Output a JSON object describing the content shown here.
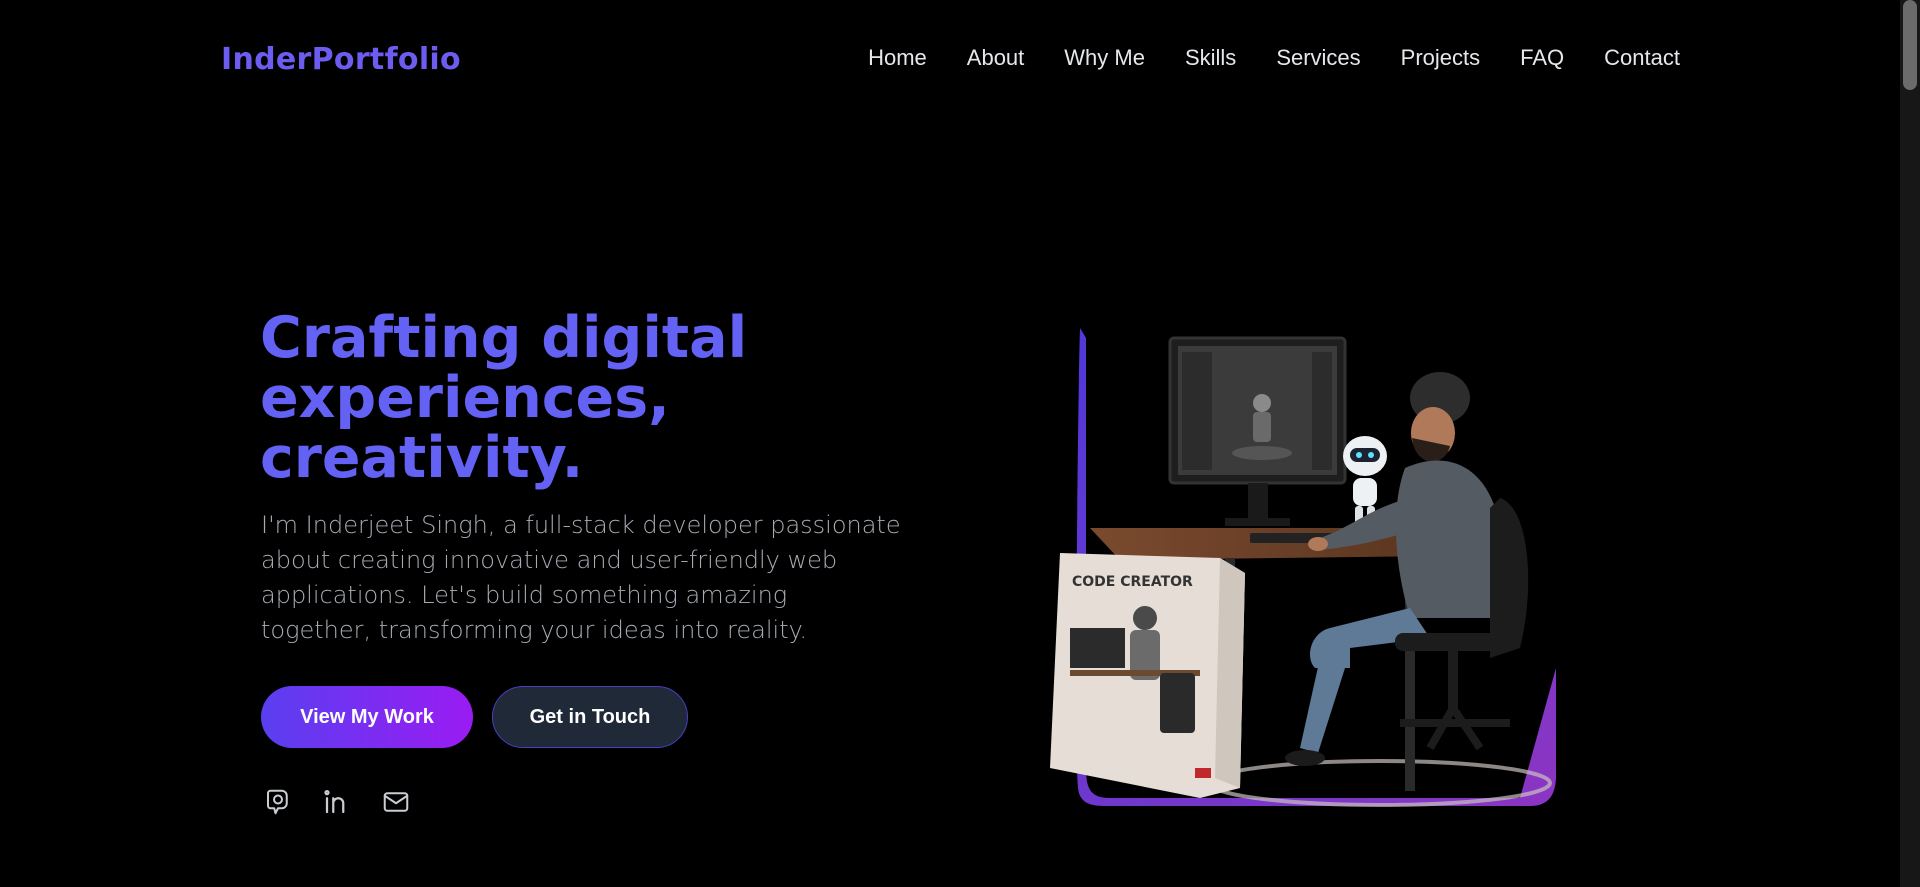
{
  "nav": {
    "logo": "InderPortfolio",
    "links": [
      "Home",
      "About",
      "Why Me",
      "Skills",
      "Services",
      "Projects",
      "FAQ",
      "Contact"
    ]
  },
  "hero": {
    "title_lines": [
      "Crafting digital",
      "experiences,",
      "creativity."
    ],
    "description": "I'm Inderjeet Singh, a full-stack developer passionate about creating innovative and user-friendly web applications. Let's build something amazing together, transforming your ideas into reality.",
    "primary_button": "View My Work",
    "secondary_button": "Get in Touch"
  },
  "socials": [
    {
      "icon": "github-icon"
    },
    {
      "icon": "linkedin-icon"
    },
    {
      "icon": "mail-icon"
    }
  ],
  "illustration": {
    "box_label": "CODE CREATOR"
  },
  "colors": {
    "accent": "#6461f5",
    "logo": "#6d5cf0",
    "button_gradient_start": "#5a3ff0",
    "button_gradient_end": "#9a1cf2",
    "secondary_button_bg": "#1f2937",
    "background": "#000000"
  }
}
